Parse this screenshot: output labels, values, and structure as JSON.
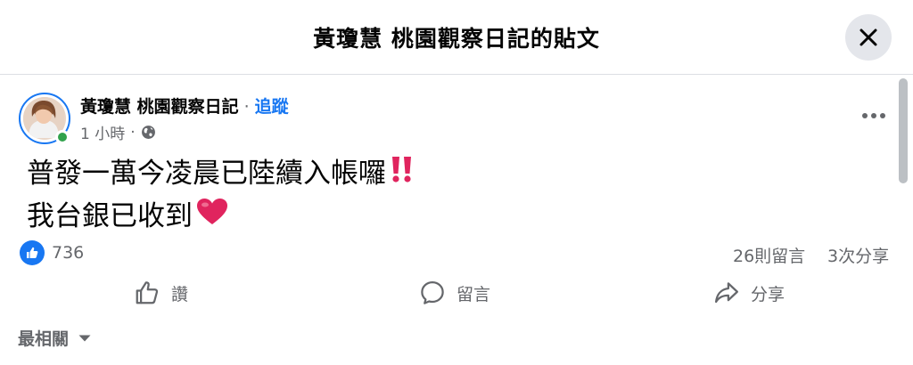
{
  "header": {
    "title": "黃瓊慧 桃園觀察日記的貼文",
    "close_icon": "close-icon"
  },
  "post": {
    "author": "黃瓊慧 桃園觀察日記",
    "separator": "·",
    "follow_label": "追蹤",
    "time": "1 小時",
    "audience_icon": "globe-icon",
    "more_icon": "more-options-icon",
    "text_line1": "普發一萬今凌晨已陸續入帳囉",
    "text_line1_emoji": "double-exclamation-emoji",
    "text_line2": "我台銀已收到",
    "text_line2_emoji": "red-heart-emoji"
  },
  "stats": {
    "like_count": "736",
    "comments": "26則留言",
    "shares": "3次分享"
  },
  "actions": {
    "like_label": "讚",
    "comment_label": "留言",
    "share_label": "分享"
  },
  "comments_sort": {
    "label": "最相關"
  },
  "colors": {
    "accent": "#1877f2",
    "online": "#31a24c",
    "secondary_text": "#65676b",
    "emoji_red": "#e0245e"
  }
}
